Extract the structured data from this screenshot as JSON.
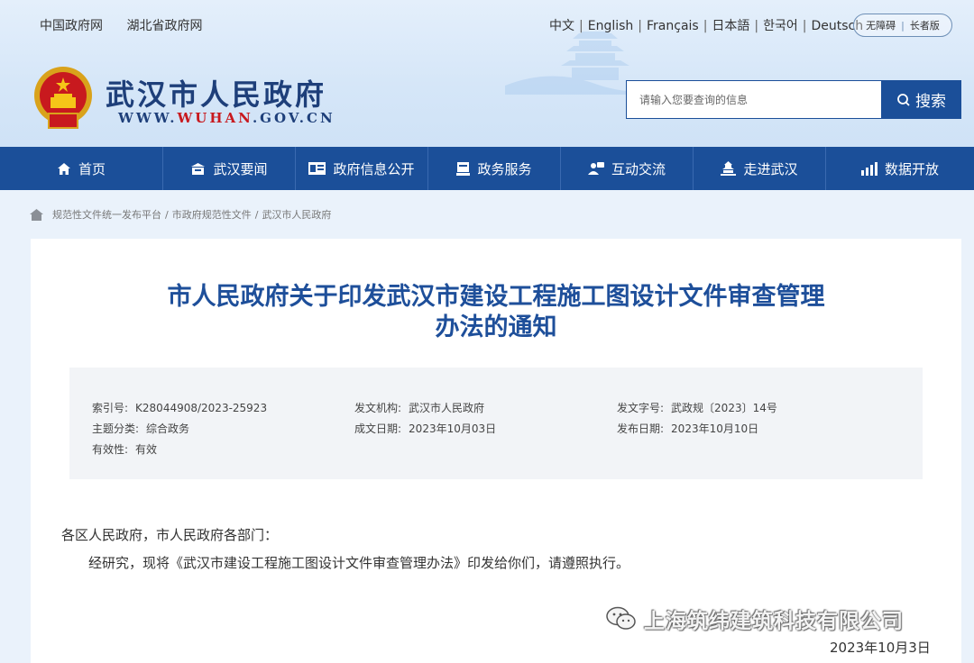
{
  "top_links": [
    "中国政府网",
    "湖北省政府网"
  ],
  "languages": [
    "中文",
    "English",
    "Français",
    "日本語",
    "한국어",
    "Deutsch"
  ],
  "accessibility": {
    "barrier_free": "无障碍",
    "elderly": "长者版"
  },
  "site": {
    "title": "武汉市人民政府",
    "url_prefix": "WWW.",
    "url_highlight": "WUHAN",
    "url_suffix": ".GOV.CN"
  },
  "search": {
    "placeholder": "请输入您要查询的信息",
    "button": "搜索"
  },
  "nav": [
    {
      "label": "首页",
      "icon": "home-icon"
    },
    {
      "label": "武汉要闻",
      "icon": "news-icon"
    },
    {
      "label": "政府信息公开",
      "icon": "info-card-icon"
    },
    {
      "label": "政务服务",
      "icon": "service-icon"
    },
    {
      "label": "互动交流",
      "icon": "chat-icon"
    },
    {
      "label": "走进武汉",
      "icon": "building-icon"
    },
    {
      "label": "数据开放",
      "icon": "data-icon"
    }
  ],
  "breadcrumb": [
    "规范性文件统一发布平台",
    "市政府规范性文件",
    "武汉市人民政府"
  ],
  "document": {
    "title_line1": "市人民政府关于印发武汉市建设工程施工图设计文件审查管理",
    "title_line2": "办法的通知",
    "meta": {
      "index_label": "索引号:",
      "index_value": "K28044908/2023-25923",
      "issuer_label": "发文机构:",
      "issuer_value": "武汉市人民政府",
      "doc_no_label": "发文字号:",
      "doc_no_value": "武政规〔2023〕14号",
      "category_label": "主题分类:",
      "category_value": "综合政务",
      "created_label": "成文日期:",
      "created_value": "2023年10月03日",
      "published_label": "发布日期:",
      "published_value": "2023年10月10日",
      "validity_label": "有效性:",
      "validity_value": "有效"
    },
    "salutation": "各区人民政府，市人民政府各部门：",
    "body": "经研究，现将《武汉市建设工程施工图设计文件审查管理办法》印发给你们，请遵照执行。",
    "date": "2023年10月3日"
  },
  "watermark": "上海筑纬建筑科技有限公司",
  "colors": {
    "primary": "#1b4f99",
    "title": "#1e4f9a",
    "brand_red": "#c8191e"
  }
}
